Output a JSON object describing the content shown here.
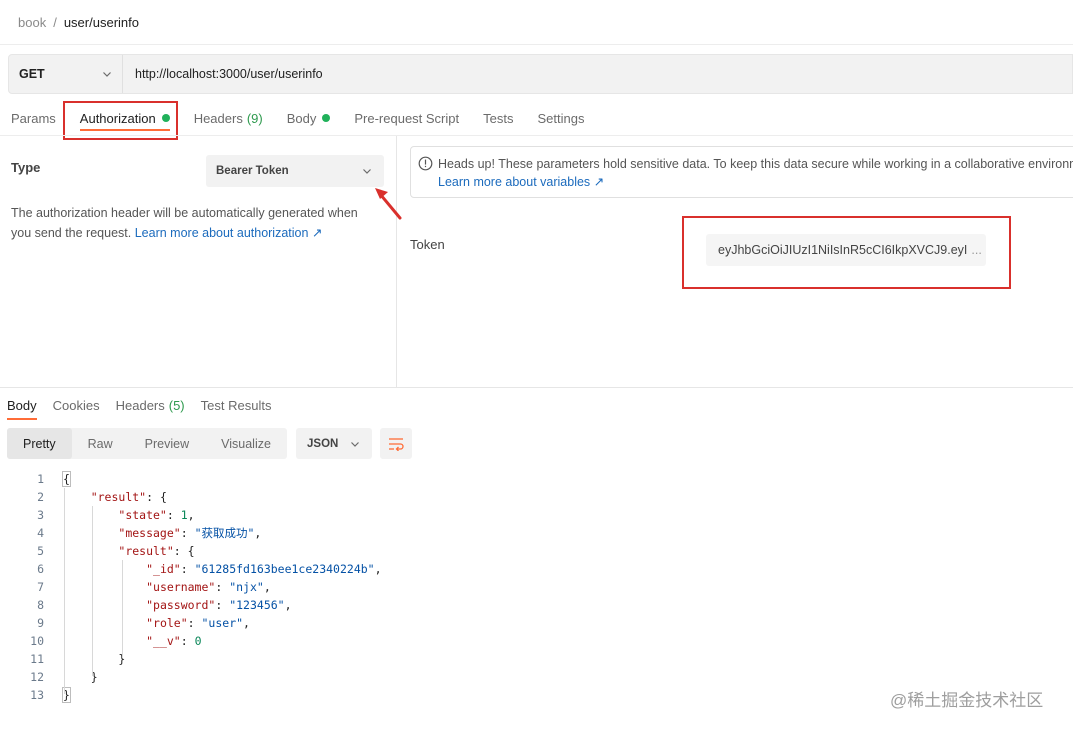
{
  "breadcrumb": {
    "parent": "book",
    "separator": "/",
    "current": "user/userinfo"
  },
  "request": {
    "method": "GET",
    "url": "http://localhost:3000/user/userinfo"
  },
  "request_tabs": [
    {
      "label": "Params"
    },
    {
      "label": "Authorization",
      "active": true,
      "indicator": "green-dot"
    },
    {
      "label": "Headers",
      "count": "(9)"
    },
    {
      "label": "Body",
      "indicator": "green-dot"
    },
    {
      "label": "Pre-request Script"
    },
    {
      "label": "Tests"
    },
    {
      "label": "Settings"
    }
  ],
  "auth": {
    "type_label": "Type",
    "type_value": "Bearer Token",
    "description": "The authorization header will be automatically generated when you send the request.",
    "description_link": "Learn more about authorization ↗",
    "notice_text": "Heads up! These parameters hold sensitive data. To keep this data secure while working in a collaborative environment",
    "notice_link": "Learn more about variables ↗",
    "token_label": "Token",
    "token_value": "eyJhbGciOiJIUzI1NiIsInR5cCI6IkpXVCJ9.eyI",
    "token_ellipsis": "..."
  },
  "response_tabs": [
    {
      "label": "Body",
      "active": true
    },
    {
      "label": "Cookies"
    },
    {
      "label": "Headers",
      "count": "(5)"
    },
    {
      "label": "Test Results"
    }
  ],
  "view_modes": [
    {
      "label": "Pretty",
      "active": true
    },
    {
      "label": "Raw"
    },
    {
      "label": "Preview"
    },
    {
      "label": "Visualize"
    }
  ],
  "format": "JSON",
  "code_lines": [
    {
      "n": "1",
      "text": "{"
    },
    {
      "n": "2",
      "text": "    \"result\": {"
    },
    {
      "n": "3",
      "text": "        \"state\": 1,"
    },
    {
      "n": "4",
      "text": "        \"message\": \"获取成功\","
    },
    {
      "n": "5",
      "text": "        \"result\": {"
    },
    {
      "n": "6",
      "text": "            \"_id\": \"61285fd163bee1ce2340224b\","
    },
    {
      "n": "7",
      "text": "            \"username\": \"njx\","
    },
    {
      "n": "8",
      "text": "            \"password\": \"123456\","
    },
    {
      "n": "9",
      "text": "            \"role\": \"user\","
    },
    {
      "n": "10",
      "text": "            \"__v\": 0"
    },
    {
      "n": "11",
      "text": "        }"
    },
    {
      "n": "12",
      "text": "    }"
    },
    {
      "n": "13",
      "text": "}"
    }
  ],
  "watermark": "@稀土掘金技术社区",
  "colors": {
    "accent": "#ff6c37",
    "green": "#20b15a",
    "annotation_red": "#d9302c",
    "link": "#1c6bbd"
  }
}
